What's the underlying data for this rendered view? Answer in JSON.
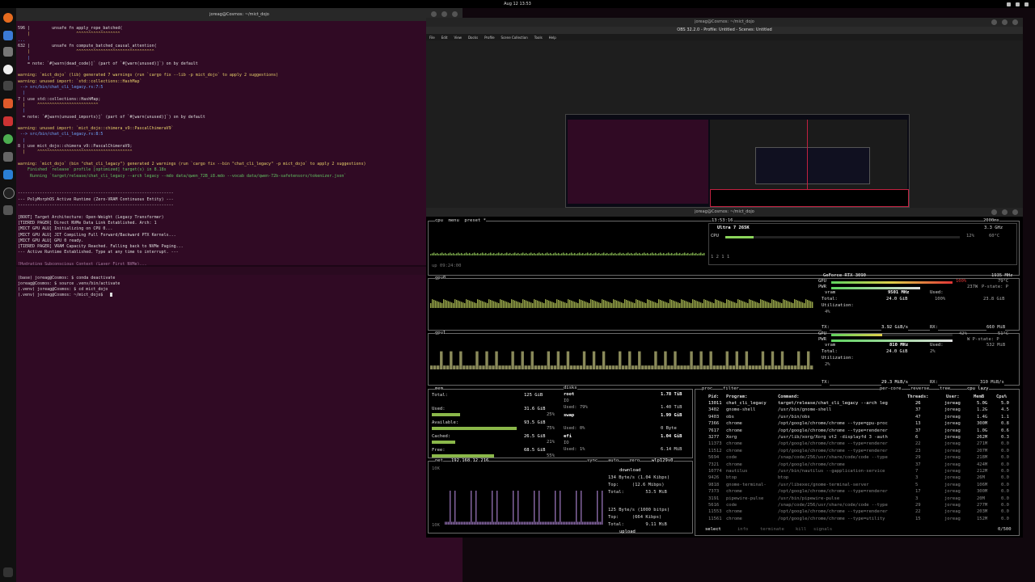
{
  "topbar": {
    "clock": "Aug 12  13:53"
  },
  "terminal": {
    "title": "joreag@Cosmos: ~/mict_dojo",
    "lines": [
      {
        "text": "596 |         unsafe fn apply_rope_batched(",
        "cls": "c-w"
      },
      {
        "text": "    |                   ^^^^^^^^^^^^^^^^^^",
        "cls": "c-y"
      },
      {
        "text": "...",
        "cls": "c-b"
      },
      {
        "text": "632 |         unsafe fn compute_batched_causal_attention(",
        "cls": "c-w"
      },
      {
        "text": "    |                   ^^^^^^^^^^^^^^^^^^^^^^^^^^^^^^^^",
        "cls": "c-y"
      },
      {
        "text": "    |",
        "cls": "c-b"
      },
      {
        "text": "    = note: `#[warn(dead_code)]` (part of `#[warn(unused)]`) on by default",
        "cls": "c-w"
      },
      {
        "text": "",
        "cls": "c-w"
      },
      {
        "text": "warning: `mict_dojo` (lib) generated 7 warnings (run `cargo fix --lib -p mict_dojo` to apply 2 suggestions)",
        "cls": "c-y"
      },
      {
        "text": "warning: unused import: `std::collections::HashMap`",
        "cls": "c-y"
      },
      {
        "text": " --> src/bin/chat_cli_legacy.rs:7:5",
        "cls": "c-b"
      },
      {
        "text": "  |",
        "cls": "c-b"
      },
      {
        "text": "7 | use std::collections::HashMap;",
        "cls": "c-w"
      },
      {
        "text": "  |     ^^^^^^^^^^^^^^^^^^^^^^^^^",
        "cls": "c-y"
      },
      {
        "text": "  |",
        "cls": "c-b"
      },
      {
        "text": "  = note: `#[warn(unused_imports)]` (part of `#[warn(unused)]`) on by default",
        "cls": "c-w"
      },
      {
        "text": "",
        "cls": "c-w"
      },
      {
        "text": "warning: unused import: `mict_dojo::chimera_v9::PascalChimeraV9`",
        "cls": "c-y"
      },
      {
        "text": " --> src/bin/chat_cli_legacy.rs:8:5",
        "cls": "c-b"
      },
      {
        "text": "  |",
        "cls": "c-b"
      },
      {
        "text": "8 | use mict_dojo::chimera_v9::PascalChimeraV9;",
        "cls": "c-w"
      },
      {
        "text": "  |     ^^^^^^^^^^^^^^^^^^^^^^^^^^^^^^^^^^^^^^^",
        "cls": "c-y"
      },
      {
        "text": "",
        "cls": "c-w"
      },
      {
        "text": "warning: `mict_dojo` (bin \"chat_cli_legacy\") generated 2 warnings (run `cargo fix --bin \"chat_cli_legacy\" -p mict_dojo` to apply 2 suggestions)",
        "cls": "c-y"
      },
      {
        "text": "    Finished `release` profile [optimized] target(s) in 8.18s",
        "cls": "c-g"
      },
      {
        "text": "     Running `target/release/chat_cli_legacy --arch legacy --mdo data/qwen_72B_i8.mdo --vocab data/qwen-72b-safetensors/tokenizer.json`",
        "cls": "c-g"
      },
      {
        "text": "",
        "cls": "c-w"
      },
      {
        "text": "",
        "cls": "c-w"
      },
      {
        "text": "----------------------------------------------------------------",
        "cls": "c-w"
      },
      {
        "text": "--- PolyMorphOS Active Runtime (Zero-VRAM Continuous Entity) ---",
        "cls": "c-w"
      },
      {
        "text": "----------------------------------------------------------------",
        "cls": "c-w"
      },
      {
        "text": "",
        "cls": "c-w"
      },
      {
        "text": "[BOOT] Target Architecture: Open-Weight (Legacy Transformer)",
        "cls": "c-w"
      },
      {
        "text": "[TIERED PAGER] Direct NVMe Data Link Established. Arch: 1",
        "cls": "c-w"
      },
      {
        "text": "[MICT GPU ALU] Initializing on CPU 0...",
        "cls": "c-w"
      },
      {
        "text": "[MICT GPU ALU] JIT Compiling Full Forward/Backward PTX Kernels...",
        "cls": "c-w"
      },
      {
        "text": "[MICT GPU ALU] GPU 0 ready.",
        "cls": "c-w"
      },
      {
        "text": "[TIERED PAGER] VRAM Capacity Reached. Falling back to NVMe Paging...",
        "cls": "c-w"
      },
      {
        "text": "--- Active Runtime Established. Type at any time to interrupt. ---",
        "cls": "c-w"
      },
      {
        "text": "",
        "cls": "c-w"
      },
      {
        "text": "[Hydrating Subconscious Context (Layer First NVMe)...",
        "cls": "c-dim"
      }
    ],
    "lower_lines": [
      {
        "text": "(base) joreag@Cosmos: $ conda deactivate",
        "cls": "c-w"
      },
      {
        "text": "joreag@Cosmos: $ source .venv/bin/activate",
        "cls": "c-w"
      },
      {
        "text": "(.venv) joreag@Cosmos: $ cd mict_dojo",
        "cls": "c-w"
      },
      {
        "text": "(.venv) joreag@Cosmos: ~/mict_dojo$ ",
        "cls": "c-w"
      }
    ]
  },
  "obs": {
    "gnome_title": "joreag@Cosmos: ~/mict_dojo",
    "title": "OBS 32.2.0 - Profile: Untitled - Scenes: Untitled",
    "menu": [
      "File",
      "Edit",
      "View",
      "Docks",
      "Profile",
      "Scene Collection",
      "Tools",
      "Help"
    ]
  },
  "btop": {
    "window_title": "joreag@Cosmos: ~/mict_dojo",
    "cpu": {
      "header": "cpu  menu  preset *",
      "time": "13:53:16",
      "refresh": "2000ms",
      "model": "Ultra 7 265K",
      "freq": "3.3 GHz",
      "cpu_label": "CPU",
      "cpu_pct": "12%",
      "cpu_temp": "60°C",
      "cpu_pct_val": 12,
      "load": "1 2 1 1",
      "uptime": "up 09:24:00"
    },
    "gpu0": {
      "label": "gpu0",
      "name": "GeForce RTX 3090",
      "clock": "1935 MHz",
      "gpu_label": "GPU",
      "gpu_pct": "100%",
      "gpu_pct_val": 100,
      "temp": "79°C",
      "pwr_label": "PWR",
      "pwr": "237W",
      "pstate": "P-state: P",
      "vram_label": "vram",
      "vram_clock": "9501 MHz",
      "used_label": "Used:",
      "used_val": "23.8 GiB",
      "total_label": "Total:",
      "total_val": "24.0 GiB",
      "used_pct": "100%",
      "util_label": "Utilization:",
      "util_val": "4%",
      "tx_label": "TX:",
      "tx": "3.92 GiB/s",
      "rx_label": "RX:",
      "rx": "660 MiB"
    },
    "gpu1": {
      "label": "gpu1",
      "gpu_label": "GPU",
      "gpu_pct": "42%",
      "gpu_pct_val": 42,
      "temp": "51°C",
      "pwr_label": "PWR",
      "pstate": "W P-state: P",
      "vram_label": "vram",
      "vram_clock": "810 MHz",
      "used_label": "Used:",
      "used_val": "532 MiB",
      "total_label": "Total:",
      "total_val": "24.0 GiB",
      "used_pct": "2%",
      "util_label": "Utilization:",
      "util_val": "2%",
      "tx_label": "TX:",
      "tx": "29.3 MiB/s",
      "rx_label": "RX:",
      "rx": "310 MiB/s"
    },
    "mem": {
      "title": "mem",
      "rows": [
        {
          "label": "Total:",
          "value": "125 GiB",
          "pct": ""
        },
        {
          "label": "Used:",
          "value": "31.6 GiB",
          "pct": "25%"
        },
        {
          "label": "Available:",
          "value": "93.5 GiB",
          "pct": "75%"
        },
        {
          "label": "Cached:",
          "value": "26.5 GiB",
          "pct": "21%"
        },
        {
          "label": "Free:",
          "value": "68.5 GiB",
          "pct": "55%"
        }
      ]
    },
    "disks": {
      "title": "disks",
      "entries": [
        {
          "name": "root",
          "size": "1.78 TiB",
          "io": "IO",
          "used": "Used: 79%",
          "used_val": "1.40 TiB"
        },
        {
          "name": "swap",
          "size": "1.99 GiB",
          "io": "",
          "used": "Used:  0%",
          "used_val": "0 Byte"
        },
        {
          "name": "efi",
          "size": "1.04 GiB",
          "io": "IO",
          "used": "Used:  1%",
          "used_val": "6.14 MiB"
        }
      ]
    },
    "net": {
      "title": "net",
      "ip": "192.168.12.216",
      "iface": "wlp129s0",
      "sync": "sync",
      "auto": "auto",
      "zero": "zero",
      "scale_top": "10K",
      "scale_bottom": "10K",
      "download_label": "download",
      "download_rate": "134 Byte/s (1.04 Kibps)",
      "download_top": "Top:     (12.6 Mibps)",
      "download_total": "Total:        53.5 MiB",
      "upload_label": "upload",
      "upload_rate": "125 Byte/s (1000 bitps)",
      "upload_top": "Top:     (664 Kibps)",
      "upload_total": "Total:        9.11 MiB"
    },
    "proc": {
      "title": "proc",
      "filter": "filter",
      "per_core": "per-core",
      "reverse": "reverse",
      "tree": "tree",
      "sort": "cpu lazy",
      "headers": {
        "pid": "Pid:",
        "program": "Program:",
        "command": "Command:",
        "threads": "Threads:",
        "user": "User:",
        "mem": "MemB",
        "cpu": "Cpu%"
      },
      "rows": [
        {
          "pid": "13011",
          "program": "chat_cli_legacy",
          "command": "target/release/chat_cli_legacy --arch leg",
          "threads": "26",
          "user": "joreag",
          "mem": "5.0G",
          "cpu": "5.0"
        },
        {
          "pid": "3402",
          "program": "gnome-shell",
          "command": "/usr/bin/gnome-shell",
          "threads": "37",
          "user": "joreag",
          "mem": "1.2G",
          "cpu": "4.5"
        },
        {
          "pid": "9403",
          "program": "obs",
          "command": "/usr/bin/obs",
          "threads": "47",
          "user": "joreag",
          "mem": "1.4G",
          "cpu": "1.1"
        },
        {
          "pid": "7366",
          "program": "chrome",
          "command": "/opt/google/chrome/chrome --type=gpu-proc",
          "threads": "13",
          "user": "joreag",
          "mem": "300M",
          "cpu": "0.8"
        },
        {
          "pid": "7617",
          "program": "chrome",
          "command": "/opt/google/chrome/chrome --type=renderer",
          "threads": "37",
          "user": "joreag",
          "mem": "1.0G",
          "cpu": "0.6"
        },
        {
          "pid": "3277",
          "program": "Xorg",
          "command": "/usr/lib/xorg/Xorg vt2 -displayfd 3 -auth",
          "threads": "6",
          "user": "joreag",
          "mem": "262M",
          "cpu": "0.3"
        },
        {
          "pid": "11373",
          "program": "chrome",
          "command": "/opt/google/chrome/chrome --type=renderer",
          "threads": "22",
          "user": "joreag",
          "mem": "271M",
          "mem2": "",
          "cpu": "0.0"
        },
        {
          "pid": "11512",
          "program": "chrome",
          "command": "/opt/google/chrome/chrome --type=renderer",
          "threads": "23",
          "user": "joreag",
          "mem": "207M",
          "cpu": "0.0"
        },
        {
          "pid": "5694",
          "program": "code",
          "command": "/snap/code/256/usr/share/code/code --type",
          "threads": "29",
          "user": "joreag",
          "mem": "218M",
          "cpu": "0.0"
        },
        {
          "pid": "7321",
          "program": "chrome",
          "command": "/opt/google/chrome/chrome",
          "threads": "37",
          "user": "joreag",
          "mem": "424M",
          "cpu": "0.0"
        },
        {
          "pid": "10774",
          "program": "nautilus",
          "command": "/usr/bin/nautilus --gapplication-service",
          "threads": "7",
          "user": "joreag",
          "mem": "212M",
          "cpu": "0.0"
        },
        {
          "pid": "9426",
          "program": "btop",
          "command": "btop",
          "threads": "3",
          "user": "joreag",
          "mem": "26M",
          "cpu": "0.0"
        },
        {
          "pid": "9818",
          "program": "gnome-terminal-",
          "command": "/usr/libexec/gnome-terminal-server",
          "threads": "5",
          "user": "joreag",
          "mem": "106M",
          "cpu": "0.0"
        },
        {
          "pid": "7373",
          "program": "chrome",
          "command": "/opt/google/chrome/chrome --type=renderer",
          "threads": "17",
          "user": "joreag",
          "mem": "300M",
          "cpu": "0.0"
        },
        {
          "pid": "3191",
          "program": "pipewire-pulse",
          "command": "/usr/bin/pipewire-pulse",
          "threads": "3",
          "user": "joreag",
          "mem": "20M",
          "cpu": "0.0"
        },
        {
          "pid": "5616",
          "program": "code",
          "command": "/snap/code/256/usr/share/code/code --type",
          "threads": "29",
          "user": "joreag",
          "mem": "277M",
          "cpu": "0.0"
        },
        {
          "pid": "11553",
          "program": "chrome",
          "command": "/opt/google/chrome/chrome --type=renderer",
          "threads": "22",
          "user": "joreag",
          "mem": "203M",
          "cpu": "0.0"
        },
        {
          "pid": "11561",
          "program": "chrome",
          "command": "/opt/google/chrome/chrome --type=utility",
          "threads": "15",
          "user": "joreag",
          "mem": "152M",
          "cpu": "0.0"
        }
      ],
      "footer_select": "select",
      "footer_info": "info",
      "footer_terminate": "terminate",
      "footer_kill": "kill",
      "footer_signals": "signals",
      "footer_count": "0/500"
    }
  }
}
